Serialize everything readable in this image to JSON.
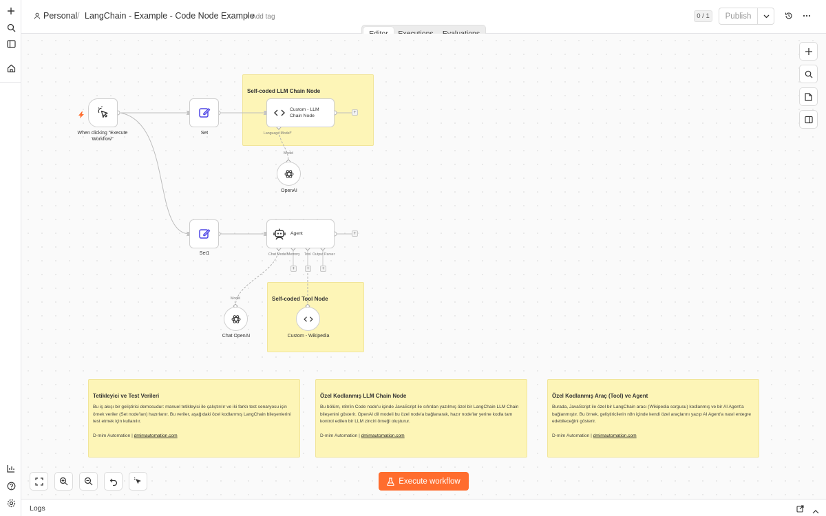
{
  "breadcrumb": {
    "project": "Personal",
    "separator": "/",
    "workflow_name": "LangChain - Example - Code Node Example",
    "add_tag": "+ Add tag"
  },
  "header": {
    "version_counter": "0 / 1",
    "publish_label": "Publish"
  },
  "tabs": [
    {
      "label": "Editor",
      "active": true
    },
    {
      "label": "Executions",
      "active": false
    },
    {
      "label": "Evaluations",
      "active": false
    }
  ],
  "stickies": {
    "chain_group": "Self-coded LLM Chain Node",
    "tool_group": "Self-coded Tool Node"
  },
  "nodes": {
    "trigger": "When clicking \"Execute Workflow\"",
    "set": "Set",
    "set1": "Set1",
    "custom_chain": "Custom - LLM Chain Node",
    "openai": "OpenAI",
    "agent": "Agent",
    "chat_openai": "Chat OpenAI",
    "custom_wiki": "Custom - Wikipedia"
  },
  "handles": {
    "language_model": "Language Model*",
    "model_top": "Model",
    "chat_model": "Chat Model*",
    "memory": "Memory",
    "tool": "Tool",
    "output_parser": "Output Parser",
    "model_bottom": "Model"
  },
  "notes": [
    {
      "title": "Tetikleyici ve Test Verileri",
      "body": "Bu iş akışı bir geliştirici demosudur: manuel tetikleyici ile çalıştırılır ve iki farklı test senaryosu için örnek veriler (Set node'ları) hazırlanır. Bu veriler, aşağıdaki özel kodlanmış LangChain bileşenlerini test etmek için kullanılır.",
      "footer_text": "D-mim Automation | ",
      "footer_link": "dmimautomation.com"
    },
    {
      "title": "Özel Kodlanmış LLM Chain Node",
      "body": "Bu bölüm, n8n'in Code node'u içinde JavaScript ile sıfırdan yazılmış özel bir LangChain LLM Chain bileşenini gösterir. OpenAI dil modeli bu özel node'a bağlanarak, hazır node'lar yerine kodla tam kontrol edilen bir LLM zinciri örneği oluşturur.",
      "footer_text": "D-mim Automation | ",
      "footer_link": "dmimautomation.com"
    },
    {
      "title": "Özel Kodlanmış Araç (Tool) ve Agent",
      "body": "Burada, JavaScript ile özel bir LangChain aracı (Wikipedia sorgusu) kodlanmış ve bir AI Agent'a bağlanmıştır. Bu örnek, geliştiricilerin n8n içinde kendi özel araçlarını yazıp AI Agent'a nasıl entegre edebileceğini gösterir.",
      "footer_text": "D-mim Automation | ",
      "footer_link": "dmimautomation.com"
    }
  ],
  "execute_label": "Execute workflow",
  "logs_label": "Logs",
  "colors": {
    "accent": "#ff6d2e",
    "sticky": "#fdf5b7",
    "edit_icon": "#4f46e5"
  }
}
